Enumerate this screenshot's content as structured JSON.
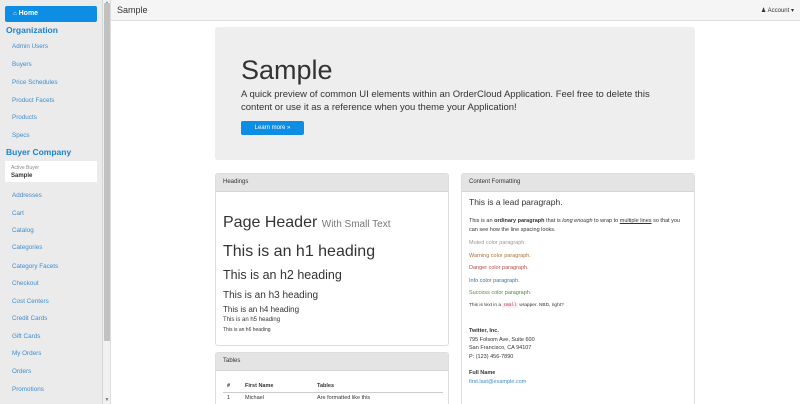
{
  "sidebar": {
    "home_icon": "home-icon",
    "home_label": "Home",
    "org_heading": "Organization",
    "org_items": [
      "Admin Users",
      "Buyers",
      "Price Schedules",
      "Product Facets",
      "Products",
      "Specs"
    ],
    "buyer_heading": "Buyer Company",
    "active_buyer_label": "Active Buyer",
    "active_buyer_value": "Sample",
    "buyer_items": [
      "Addresses",
      "Cart",
      "Catalog",
      "Categories",
      "Category Facets",
      "Checkout",
      "Cost Centers",
      "Credit Cards",
      "Gift Cards",
      "My Orders",
      "Orders",
      "Promotions"
    ]
  },
  "topbar": {
    "title": "Sample",
    "account_label": "Account"
  },
  "jumbotron": {
    "title": "Sample",
    "text": "A quick preview of common UI elements within an OrderCloud Application. Feel free to delete this content or use it as a reference when you theme your Application!",
    "button": "Learn more »"
  },
  "headings_panel": {
    "title": "Headings",
    "page_header": "Page Header",
    "page_header_small": "With Small Text",
    "h1": "This is an h1 heading",
    "h2": "This is an h2 heading",
    "h3": "This is an h3 heading",
    "h4": "This is an h4 heading",
    "h5": "This is an h5 heading",
    "h6": "This is an h6 heading"
  },
  "content_panel": {
    "title": "Content Formatting",
    "lead": "This is a lead paragraph.",
    "para_1": "This is an ",
    "para_bold": "ordinary paragraph",
    "para_2": " that is ",
    "para_italic": "long enough",
    "para_3": " to wrap to ",
    "para_underline": "multiple lines",
    "para_4": " so that you can see how the line spacing looks.",
    "muted": "Muted color paragraph.",
    "warning": "Warning color paragraph.",
    "danger": "Danger color paragraph.",
    "info": "Info color paragraph.",
    "success": "Success color paragraph.",
    "small_1": "This is text in a ",
    "small_code": "small",
    "small_2": " wrapper. NBD, right?",
    "address_name": "Twitter, Inc.",
    "address_1": "795 Folsom Ave, Suite 600",
    "address_2": "San Francisco, CA 94107",
    "address_phone": "P: (123) 456-7890",
    "contact_name": "Full Name",
    "contact_email": "first.last@example.com"
  },
  "tables_panel": {
    "title": "Tables",
    "columns": [
      "#",
      "First Name",
      "Tables"
    ],
    "rows": [
      [
        "1",
        "Michael",
        "Are formatted like this"
      ]
    ]
  }
}
